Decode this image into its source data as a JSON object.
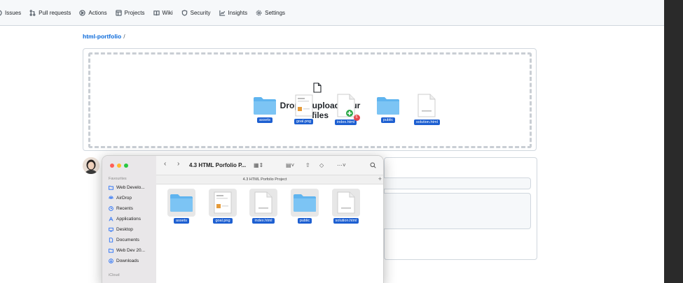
{
  "repo_nav": {
    "items": [
      {
        "label": "Issues",
        "icon": "issue-icon"
      },
      {
        "label": "Pull requests",
        "icon": "pull-request-icon"
      },
      {
        "label": "Actions",
        "icon": "play-icon"
      },
      {
        "label": "Projects",
        "icon": "table-icon"
      },
      {
        "label": "Wiki",
        "icon": "book-icon"
      },
      {
        "label": "Security",
        "icon": "shield-icon"
      },
      {
        "label": "Insights",
        "icon": "graph-icon"
      },
      {
        "label": "Settings",
        "icon": "gear-icon"
      }
    ]
  },
  "breadcrumb": {
    "repo": "html-portfolio",
    "separator": "/"
  },
  "dropzone": {
    "text": "Drop to upload your files",
    "dragged_files": [
      {
        "name": "assets",
        "kind": "folder"
      },
      {
        "name": "goal.png",
        "kind": "image"
      },
      {
        "name": "index.html",
        "kind": "html",
        "badge": "5"
      },
      {
        "name": "public",
        "kind": "folder"
      },
      {
        "name": "solution.html",
        "kind": "html"
      }
    ]
  },
  "finder": {
    "title": "4.3 HTML Porfolio P...",
    "path": "4.3 HTML Porfolio Project",
    "sidebar": {
      "favourites_heading": "Favourites",
      "items": [
        {
          "label": "Web Develo...",
          "icon": "folder-icon"
        },
        {
          "label": "AirDrop",
          "icon": "airdrop-icon"
        },
        {
          "label": "Recents",
          "icon": "clock-icon"
        },
        {
          "label": "Applications",
          "icon": "applications-icon"
        },
        {
          "label": "Desktop",
          "icon": "desktop-icon"
        },
        {
          "label": "Documents",
          "icon": "document-icon"
        },
        {
          "label": "Web Dev 20...",
          "icon": "folder-icon"
        },
        {
          "label": "Downloads",
          "icon": "download-icon"
        }
      ],
      "icloud_heading": "iCloud"
    },
    "files": [
      {
        "name": "assets",
        "kind": "folder"
      },
      {
        "name": "goal.png",
        "kind": "image"
      },
      {
        "name": "index.html",
        "kind": "html"
      },
      {
        "name": "public",
        "kind": "folder"
      },
      {
        "name": "solution.html",
        "kind": "html"
      }
    ]
  },
  "colors": {
    "accent": "#0969da",
    "selection": "#1d5fd1",
    "folder": "#5fb4ef"
  }
}
